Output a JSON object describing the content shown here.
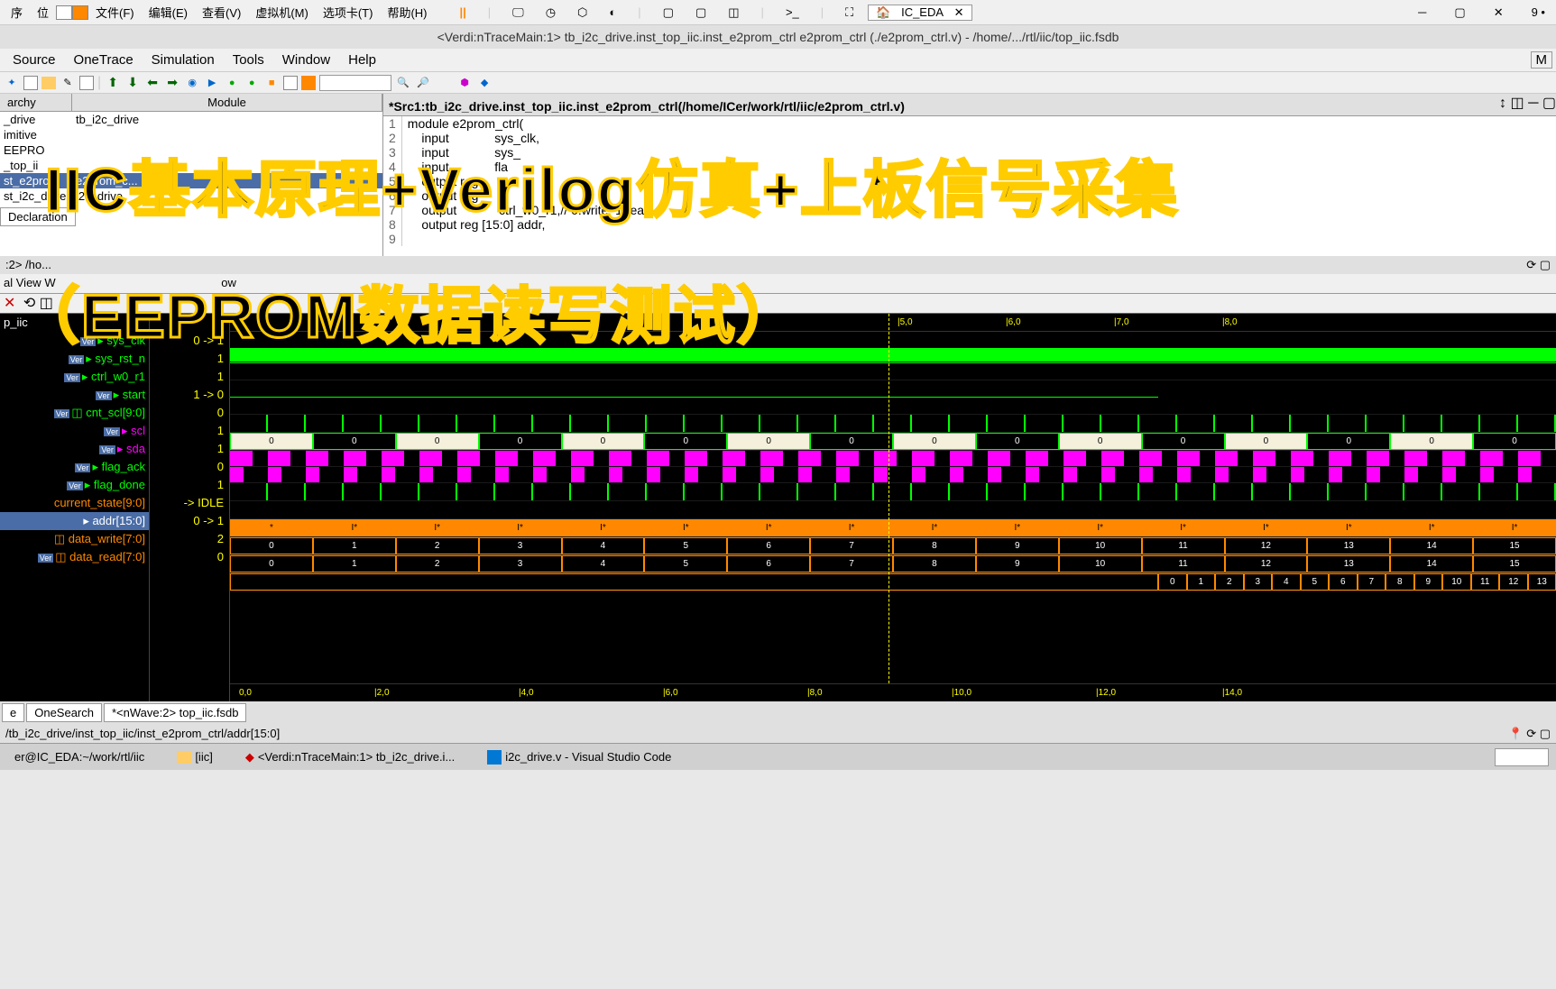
{
  "menubar": {
    "items": [
      "序",
      "位",
      "文件(F)",
      "编辑(E)",
      "查看(V)",
      "虚拟机(M)",
      "选项卡(T)",
      "帮助(H)"
    ],
    "tab": "IC_EDA"
  },
  "title": "<Verdi:nTraceMain:1> tb_i2c_drive.inst_top_iic.inst_e2prom_ctrl e2prom_ctrl (./e2prom_ctrl.v) - /home/.../rtl/iic/top_iic.fsdb",
  "main_menu": [
    "Source",
    "OneTrace",
    "Simulation",
    "Tools",
    "Window",
    "Help"
  ],
  "hierarchy": {
    "header_left": "archy",
    "header_right": "Module",
    "rows": [
      {
        "name": "_drive",
        "module": "tb_i2c_drive"
      },
      {
        "name": "imitive",
        "module": ""
      },
      {
        "name": "EEPRO",
        "module": ""
      },
      {
        "name": "_top_ii",
        "module": ""
      },
      {
        "name": "st_e2pro...",
        "module": "e2prom_c...",
        "selected": true
      },
      {
        "name": "st_i2c_drive",
        "module": "i2c_drive"
      }
    ],
    "declaration_tab": "Declaration",
    "nwave_label": ":2> /ho..."
  },
  "source": {
    "title": "*Src1:tb_i2c_drive.inst_top_iic.inst_e2prom_ctrl(/home/ICer/work/rtl/iic/e2prom_ctrl.v)",
    "lines": [
      {
        "n": 1,
        "text": "module e2prom_ctrl("
      },
      {
        "n": 2,
        "text": "    input             sys_clk,"
      },
      {
        "n": 3,
        "text": "    input             sys_"
      },
      {
        "n": 4,
        "text": "    input             fla"
      },
      {
        "n": 5,
        "text": ""
      },
      {
        "n": 6,
        "text": "    output reg"
      },
      {
        "n": 7,
        "text": "    output reg"
      },
      {
        "n": 8,
        "text": "    output            ctrl_w0_r1,// 0:write  1:read"
      },
      {
        "n": 9,
        "text": "    output reg [15:0] addr,"
      }
    ]
  },
  "overlay1": "IIC基本原理+Verilog仿真+上板信号采集",
  "overlay2": "（EEPROM数据读写测试）",
  "waveform": {
    "group": "p_iic",
    "signals": [
      {
        "name": "sys_clk",
        "value": "0 -> 1",
        "color": "#0f0"
      },
      {
        "name": "sys_rst_n",
        "value": "1",
        "color": "#0f0"
      },
      {
        "name": "ctrl_w0_r1",
        "value": "1",
        "color": "#0f0"
      },
      {
        "name": "start",
        "value": "1 -> 0",
        "color": "#0f0"
      },
      {
        "name": "cnt_scl[9:0]",
        "value": "0",
        "color": "#0f0"
      },
      {
        "name": "scl",
        "value": "1",
        "color": "#f0f"
      },
      {
        "name": "sda",
        "value": "1",
        "color": "#f0f"
      },
      {
        "name": "flag_ack",
        "value": "0",
        "color": "#0f0"
      },
      {
        "name": "flag_done",
        "value": "1",
        "color": "#0f0"
      },
      {
        "name": "current_state[9:0]",
        "value": "-> IDLE",
        "color": "#f80"
      },
      {
        "name": "addr[15:0]",
        "value": "0 -> 1",
        "color": "#f80",
        "selected": true
      },
      {
        "name": "data_write[7:0]",
        "value": "2",
        "color": "#f80"
      },
      {
        "name": "data_read[7:0]",
        "value": "0",
        "color": "#f80"
      }
    ],
    "time_top": [
      "|5,0",
      "|6,0",
      "|7,0",
      "|8,0"
    ],
    "time_bottom": [
      "0,0",
      "|2,0",
      "|4,0",
      "|6,0",
      "|8,0",
      "|10,0",
      "|12,0",
      "|14,0"
    ],
    "bus_values": [
      "0",
      "1",
      "2",
      "3",
      "4",
      "5",
      "6",
      "7",
      "8",
      "9",
      "10",
      "11",
      "12",
      "13",
      "14",
      "15"
    ],
    "state_values": [
      "*",
      "I*",
      "I*",
      "I*",
      "I*",
      "I*",
      "I*",
      "I*",
      "I*",
      "I*",
      "I*",
      "I*",
      "I*",
      "I*",
      "I*",
      "I*"
    ],
    "read_values": [
      "0",
      "1",
      "2",
      "3",
      "4",
      "5",
      "6",
      "7",
      "8",
      "9",
      "10",
      "11",
      "12",
      "13"
    ]
  },
  "bottom_tabs": [
    "e",
    "OneSearch",
    "*<nWave:2> top_iic.fsdb"
  ],
  "path_bar": "/tb_i2c_drive/inst_top_iic/inst_e2prom_ctrl/addr[15:0]",
  "taskbar": {
    "terminal": "er@IC_EDA:~/work/rtl/iic",
    "folder": "[iic]",
    "verdi": "<Verdi:nTraceMain:1> tb_i2c_drive.i...",
    "vscode": "i2c_drive.v - Visual Studio Code"
  }
}
